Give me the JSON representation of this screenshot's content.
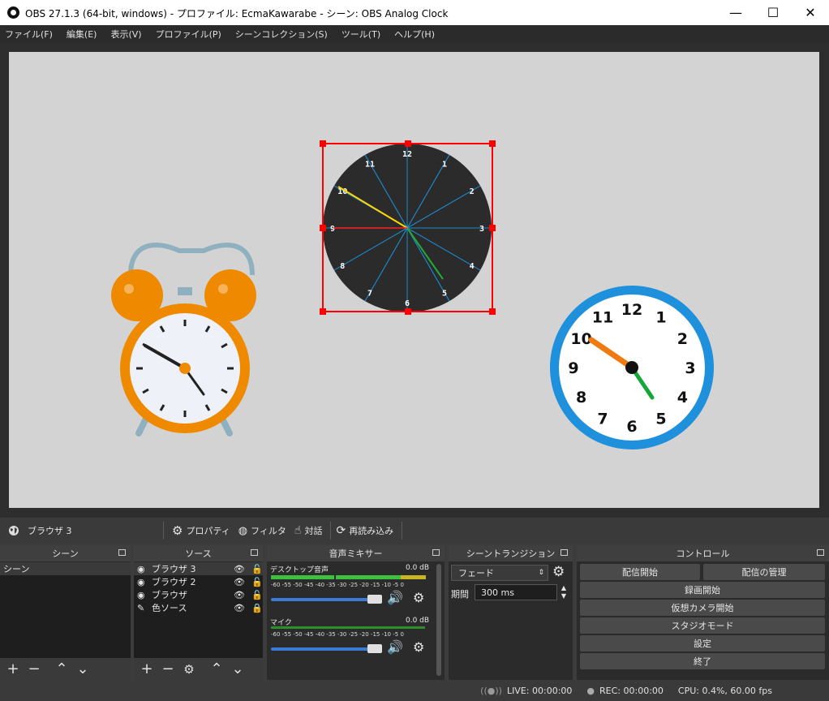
{
  "window": {
    "title": "OBS 27.1.3 (64-bit, windows) - プロファイル: EcmaKawarabe - シーン: OBS Analog Clock",
    "minimize_icon": "—",
    "maximize_icon": "☐",
    "close_icon": "✕"
  },
  "menu": [
    "ファイル(F)",
    "編集(E)",
    "表示(V)",
    "プロファイル(P)",
    "シーンコレクション(S)",
    "ツール(T)",
    "ヘルプ(H)"
  ],
  "source_toolbar": {
    "selected_source": "ブラウザ 3",
    "properties": "プロパティ",
    "filters": "フィルタ",
    "interact": "対話",
    "reload": "再読み込み"
  },
  "clock_center": {
    "numbers": [
      "12",
      "1",
      "2",
      "3",
      "4",
      "5",
      "6",
      "7",
      "8",
      "9",
      "10",
      "11"
    ]
  },
  "clock_right": {
    "numbers": [
      "12",
      "1",
      "2",
      "3",
      "4",
      "5",
      "6",
      "7",
      "8",
      "9",
      "10",
      "11"
    ]
  },
  "scenes": {
    "header": "シーン",
    "items": [
      "シーン"
    ]
  },
  "sources": {
    "header": "ソース",
    "items": [
      {
        "name": "ブラウザ 3",
        "icon": "globe-icon"
      },
      {
        "name": "ブラウザ 2",
        "icon": "globe-icon"
      },
      {
        "name": "ブラウザ",
        "icon": "globe-icon"
      },
      {
        "name": "色ソース",
        "icon": "brush-icon"
      }
    ]
  },
  "mixer": {
    "header": "音声ミキサー",
    "channels": [
      {
        "name": "デスクトップ音声",
        "level": "0.0 dB"
      },
      {
        "name": "マイク",
        "level": "0.0 dB"
      }
    ],
    "scale": [
      "-60",
      "-55",
      "-50",
      "-45",
      "-40",
      "-35",
      "-30",
      "-25",
      "-20",
      "-15",
      "-10",
      "-5",
      "0"
    ]
  },
  "transitions": {
    "header": "シーントランジション",
    "selected": "フェード",
    "duration_label": "期間",
    "duration_value": "300 ms"
  },
  "controls": {
    "header": "コントロール",
    "start_streaming": "配信開始",
    "manage_broadcast": "配信の管理",
    "start_recording": "録画開始",
    "start_virtual_camera": "仮想カメラ開始",
    "studio_mode": "スタジオモード",
    "settings": "設定",
    "exit": "終了"
  },
  "status": {
    "live": "LIVE: 00:00:00",
    "rec": "REC: 00:00:00",
    "cpu": "CPU: 0.4%, 60.00 fps"
  },
  "colors": {
    "selection": "#ff0000",
    "alarm_orange": "#ef8a00",
    "clock_blue": "#1e90dc",
    "canvas": "#d3d3d3"
  }
}
